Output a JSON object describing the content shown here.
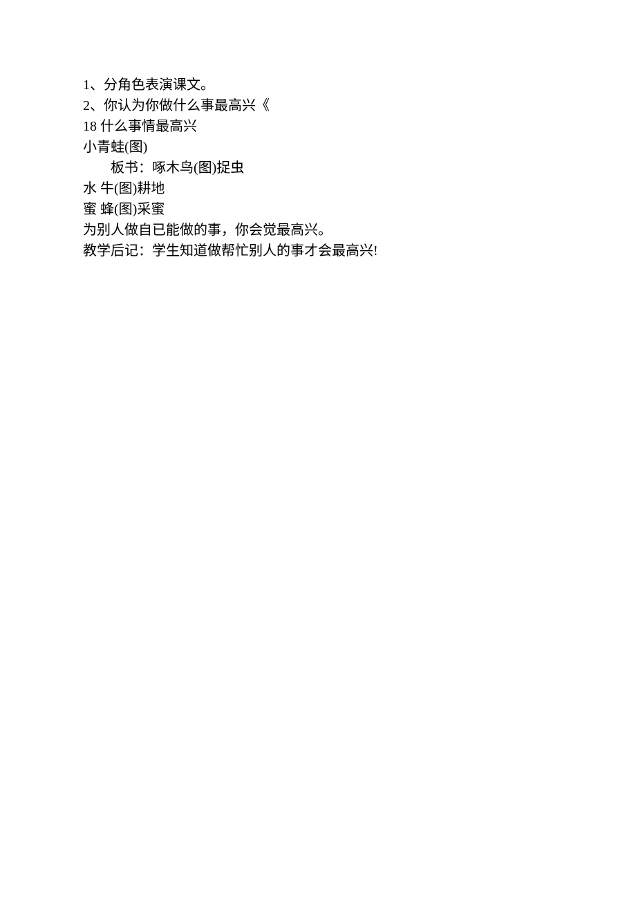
{
  "lines": [
    {
      "text": "1、分角色表演课文。",
      "indent": false
    },
    {
      "text": "2、你认为你做什么事最高兴《",
      "indent": false
    },
    {
      "text": "18 什么事情最高兴",
      "indent": false
    },
    {
      "text": "小青蛙(图)",
      "indent": false
    },
    {
      "text": "板书：啄木鸟(图)捉虫",
      "indent": true
    },
    {
      "text": "水 牛(图)耕地",
      "indent": false
    },
    {
      "text": "蜜 蜂(图)采蜜",
      "indent": false
    },
    {
      "text": "为别人做自已能做的事，你会觉最高兴。",
      "indent": false
    },
    {
      "text": "教学后记：学生知道做帮忙别人的事才会最高兴!",
      "indent": false
    }
  ]
}
